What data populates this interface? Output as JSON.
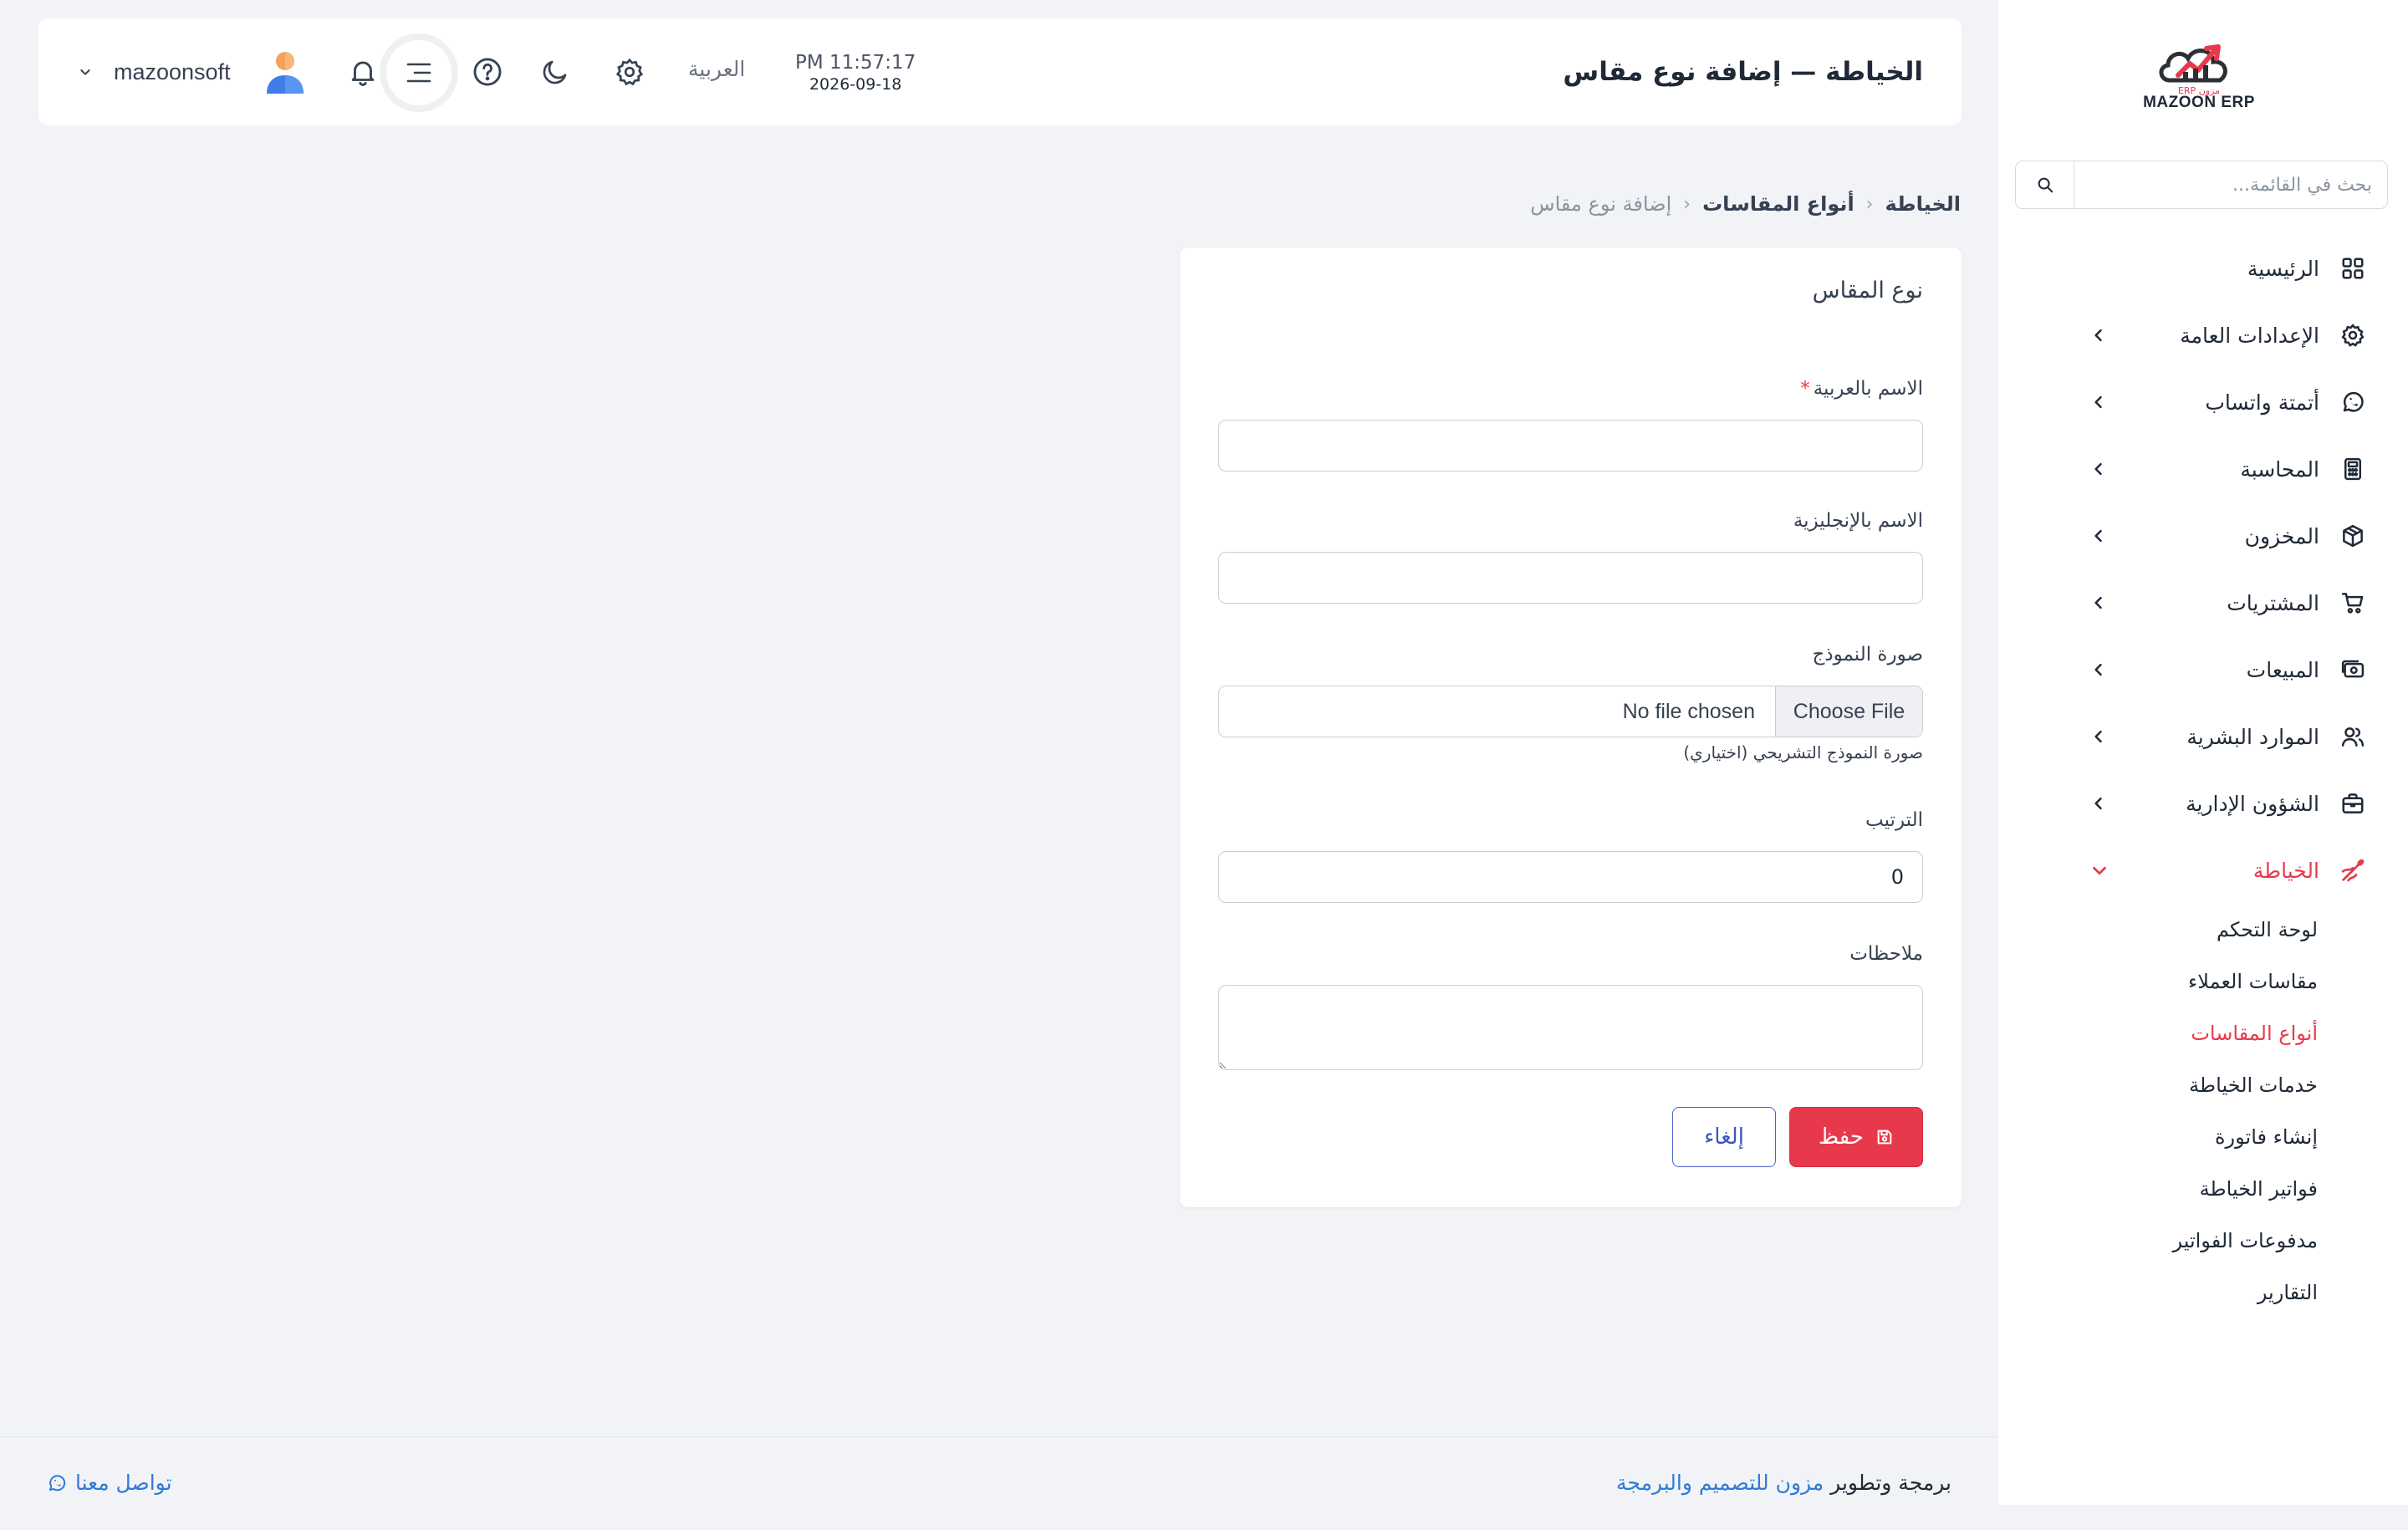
{
  "sidebar": {
    "logo_text": "MAZOON ERP",
    "logo_subtext": "ERP مزون",
    "search_placeholder": "بحث في القائمة...",
    "items": [
      {
        "label": "الرئيسية",
        "icon": "grid-icon"
      },
      {
        "label": "الإعدادات العامة",
        "icon": "gear-icon"
      },
      {
        "label": "أتمتة واتساب",
        "icon": "whatsapp-icon"
      },
      {
        "label": "المحاسبة",
        "icon": "calculator-icon"
      },
      {
        "label": "المخزون",
        "icon": "box-icon"
      },
      {
        "label": "المشتريات",
        "icon": "cart-icon"
      },
      {
        "label": "المبيعات",
        "icon": "cash-icon"
      },
      {
        "label": "الموارد البشرية",
        "icon": "users-icon"
      },
      {
        "label": "الشؤون الإدارية",
        "icon": "briefcase-icon"
      },
      {
        "label": "الخياطة",
        "icon": "needle-icon"
      }
    ],
    "sub_items": [
      {
        "label": "لوحة التحكم"
      },
      {
        "label": "مقاسات العملاء"
      },
      {
        "label": "أنواع المقاسات"
      },
      {
        "label": "خدمات الخياطة"
      },
      {
        "label": "إنشاء فاتورة"
      },
      {
        "label": "فواتير الخياطة"
      },
      {
        "label": "مدفوعات الفواتير"
      },
      {
        "label": "التقارير"
      }
    ],
    "active_color": "#e8394c"
  },
  "topbar": {
    "title": "الخياطة — إضافة نوع مقاس",
    "time": "PM 11:57:17",
    "date": "2026-09-18",
    "language": "العربية",
    "username": "mazoonsoft"
  },
  "breadcrumb": {
    "level1": "الخياطة",
    "level2": "أنواع المقاسات",
    "current": "إضافة نوع مقاس"
  },
  "form": {
    "card_title": "نوع المقاس",
    "name_ar_label": "الاسم بالعربية",
    "required_mark": "*",
    "name_ar_value": "",
    "name_en_label": "الاسم بالإنجليزية",
    "name_en_value": "",
    "image_label": "صورة النموذج",
    "choose_file": "Choose File",
    "no_file": "No file chosen",
    "image_help": "صورة النموذج التشريحي (اختياري)",
    "order_label": "الترتيب",
    "order_value": "0",
    "notes_label": "ملاحظات",
    "notes_value": "",
    "save_label": "حفظ",
    "cancel_label": "إلغاء"
  },
  "footer": {
    "credit_prefix": "برمجة وتطوير",
    "credit_link": "مزون للتصميم والبرمجة",
    "contact": "تواصل معنا"
  },
  "colors": {
    "accent": "#e8394c",
    "link": "#2e7bd8",
    "cancel": "#3b55c4"
  }
}
